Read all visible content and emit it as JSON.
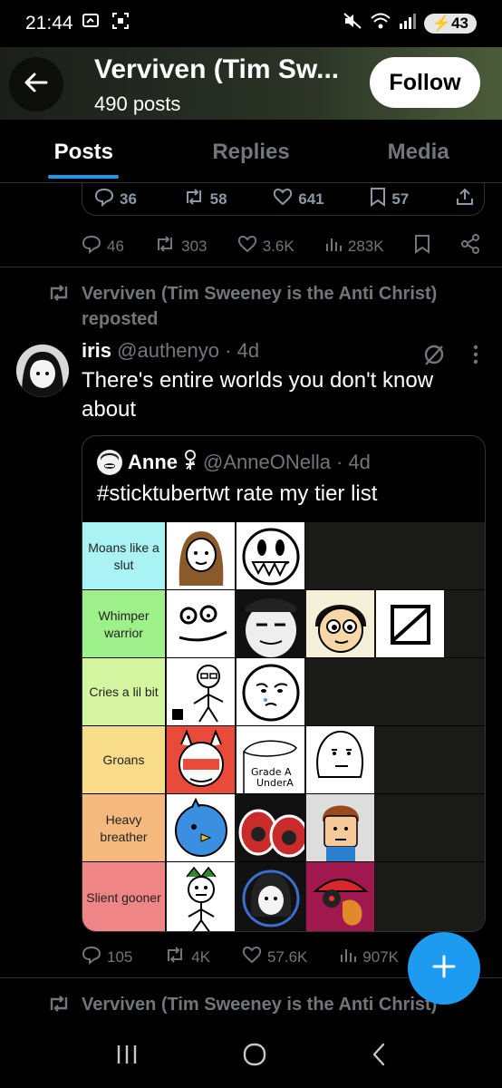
{
  "status_bar": {
    "time": "21:44",
    "battery": "43"
  },
  "header": {
    "back_label": "Back",
    "title": "Verviven (Tim Sw...",
    "posts_count": "490 posts",
    "follow_label": "Follow"
  },
  "tabs": [
    {
      "label": "Posts"
    },
    {
      "label": "Replies"
    },
    {
      "label": "Media"
    }
  ],
  "prev_quote_actions": {
    "replies": "36",
    "reposts": "58",
    "likes": "641",
    "bookmarks": "57"
  },
  "prev_post_actions": {
    "replies": "46",
    "reposts": "303",
    "likes": "3.6K",
    "views": "283K"
  },
  "repost": {
    "text": "Verviven (Tim Sweeney is the Anti Christ) reposted"
  },
  "post": {
    "author": "iris",
    "handle": "@authenyo",
    "time": "· 4d",
    "text": "There's entire worlds you don't know about",
    "quote": {
      "author": "Anne",
      "handle": "@AnneONella",
      "time": "· 4d",
      "text": "#sticktubertwt rate my tier list",
      "tiers": [
        {
          "label": "Moans like a slut",
          "color": "#aaf3f5",
          "count": 2
        },
        {
          "label": "Whimper warrior",
          "color": "#9ef08a",
          "count": 4
        },
        {
          "label": "Cries a lil bit",
          "color": "#d6f5a0",
          "count": 2
        },
        {
          "label": "Groans",
          "color": "#f8dc8a",
          "count": 3
        },
        {
          "label": "Heavy breather",
          "color": "#f6b97d",
          "count": 3
        },
        {
          "label": "Slient gooner",
          "color": "#f08585",
          "count": 3
        }
      ],
      "image_text": {
        "grade_a": "Grade A",
        "under_a": "UnderA"
      }
    },
    "actions": {
      "replies": "105",
      "reposts": "4K",
      "likes": "57.6K",
      "views": "907K"
    }
  },
  "next_repost": {
    "text": "Verviven (Tim Sweeney is the Anti Christ)"
  }
}
